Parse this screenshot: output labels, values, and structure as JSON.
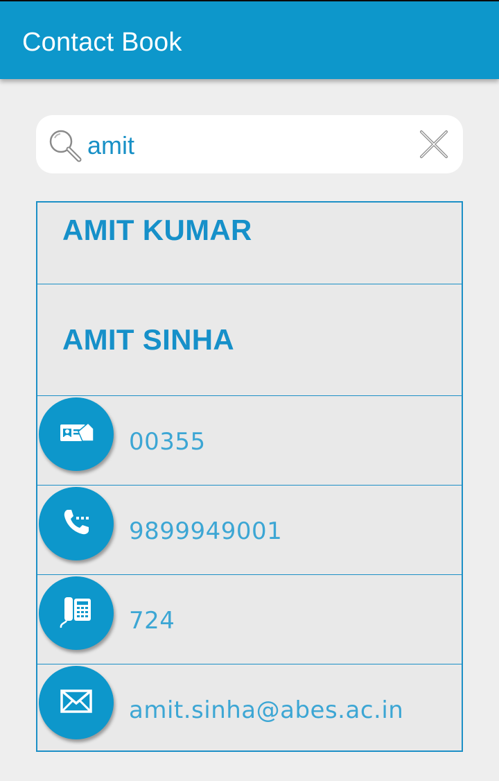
{
  "app": {
    "title": "Contact Book"
  },
  "search": {
    "value": "amit",
    "placeholder": ""
  },
  "contacts": [
    {
      "name": "AMIT KUMAR"
    },
    {
      "name": "AMIT SINHA"
    }
  ],
  "details": {
    "employee_id": "00355",
    "mobile": "9899949001",
    "extension": "724",
    "email": "amit.sinha@abes.ac.in"
  },
  "colors": {
    "primary": "#0d97cb",
    "background": "#eeeeee",
    "list_background": "#e9e9e9",
    "text_accent": "#1690c9"
  },
  "icons": {
    "search": "search-icon",
    "clear": "close-icon",
    "employee_id": "id-card-icon",
    "mobile": "phone-icon",
    "extension": "desk-phone-icon",
    "email": "mail-icon"
  }
}
